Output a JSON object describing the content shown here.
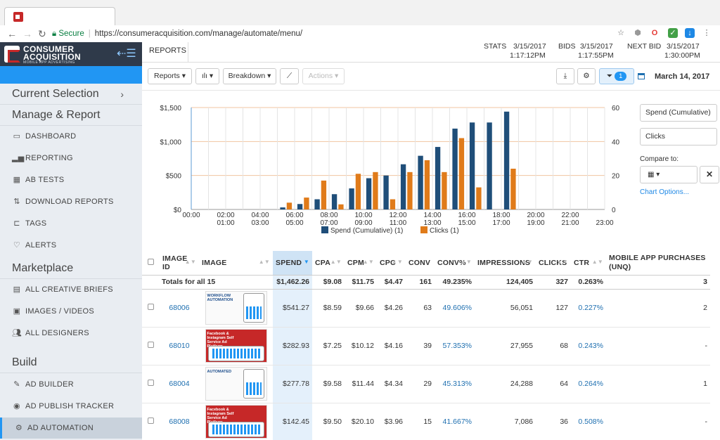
{
  "browser": {
    "secure_label": "Secure",
    "url": "https://consumeracquisition.com/manage/automate/menu/"
  },
  "brand": {
    "line1": "CONSUMER",
    "line2": "ACQUISITION",
    "tagline": "MOBILE APP ADVERTISING",
    "accent": "#2196f3"
  },
  "sidebar": {
    "current_selection": "Current Selection",
    "manage_report": "Manage & Report",
    "manage_items": [
      {
        "label": "DASHBOARD",
        "icon": "monitor-icon"
      },
      {
        "label": "REPORTING",
        "icon": "bar-chart-icon"
      },
      {
        "label": "AB TESTS",
        "icon": "grid-icon"
      },
      {
        "label": "DOWNLOAD REPORTS",
        "icon": "sort-icon"
      },
      {
        "label": "TAGS",
        "icon": "tag-icon"
      },
      {
        "label": "ALERTS",
        "icon": "bulb-icon"
      }
    ],
    "marketplace": "Marketplace",
    "marketplace_items": [
      {
        "label": "ALL CREATIVE BRIEFS",
        "icon": "document-icon"
      },
      {
        "label": "IMAGES / VIDEOS",
        "icon": "camera-icon"
      },
      {
        "label": "ALL DESIGNERS",
        "icon": "users-icon"
      }
    ],
    "build": "Build",
    "build_items": [
      {
        "label": "AD BUILDER",
        "icon": "tools-icon"
      },
      {
        "label": "AD PUBLISH TRACKER",
        "icon": "record-icon"
      },
      {
        "label": "AD AUTOMATION",
        "icon": "cogs-icon"
      }
    ]
  },
  "topbar": {
    "tab": "REPORTS",
    "stats_label": "STATS",
    "stats_date": "3/15/2017",
    "stats_time": "1:17:12PM",
    "bids_label": "BIDS",
    "bids_date": "3/15/2017",
    "bids_time": "1:17:55PM",
    "next_bid_label": "NEXT BID",
    "next_bid_date": "3/15/2017",
    "next_bid_time": "1:30:00PM"
  },
  "toolbar": {
    "reports": "Reports",
    "breakdown": "Breakdown",
    "actions": "Actions",
    "filter_count": "1",
    "date": "March 14, 2017"
  },
  "chart_controls": {
    "metric1": "Spend (Cumulative)",
    "metric2": "Clicks",
    "compare_label": "Compare to:",
    "chart_options": "Chart Options..."
  },
  "chart_data": {
    "type": "bar",
    "categories": [
      "00:00",
      "01:00",
      "02:00",
      "03:00",
      "04:00",
      "05:00",
      "06:00",
      "07:00",
      "08:00",
      "09:00",
      "10:00",
      "11:00",
      "12:00",
      "13:00",
      "14:00",
      "15:00",
      "16:00",
      "17:00",
      "18:00",
      "19:00",
      "20:00",
      "21:00",
      "22:00",
      "23:00"
    ],
    "series": [
      {
        "name": "Spend (Cumulative) (1)",
        "axis": "left",
        "color": "#1f4e79",
        "values": [
          0,
          0,
          0,
          0,
          0,
          30,
          80,
          150,
          225,
          310,
          460,
          500,
          665,
          790,
          920,
          1190,
          1280,
          1280,
          1440,
          null,
          null,
          null,
          null,
          null
        ]
      },
      {
        "name": "Clicks (1)",
        "axis": "right",
        "color": "#e07b1a",
        "values": [
          0,
          0,
          0,
          0,
          0,
          4,
          7,
          17,
          3,
          21,
          22,
          6,
          22,
          29,
          22,
          42,
          13,
          null,
          24,
          null,
          null,
          null,
          null,
          null
        ]
      }
    ],
    "y_left": {
      "ticks": [
        "$0",
        "$500",
        "$1,000",
        "$1,500"
      ],
      "range": [
        0,
        1500
      ]
    },
    "y_right": {
      "ticks": [
        "0",
        "20",
        "40",
        "60"
      ],
      "range": [
        0,
        60
      ]
    },
    "legend": [
      "Spend (Cumulative) (1)",
      "Clicks (1)"
    ],
    "legend_position": "bottom",
    "grid": true
  },
  "table": {
    "headers": [
      "IMAGE ID",
      "IMAGE",
      "SPEND",
      "CPA",
      "CPM",
      "CPC",
      "CONV",
      "CONV%",
      "IMPRESSIONS",
      "CLICKS",
      "CTR",
      "MOBILE APP PURCHASES (UNQ)"
    ],
    "totals": {
      "label": "Totals for all 15",
      "spend": "$1,462.26",
      "cpa": "$9.08",
      "cpm": "$11.75",
      "cpc": "$4.47",
      "conv": "161",
      "conv_pct": "49.235%",
      "impressions": "124,405",
      "clicks": "327",
      "ctr": "0.263%",
      "purchases": "3"
    },
    "rows": [
      {
        "id": "68006",
        "spend": "$541.27",
        "cpa": "$8.59",
        "cpm": "$9.66",
        "cpc": "$4.26",
        "conv": "63",
        "conv_pct": "49.606%",
        "impressions": "56,051",
        "clicks": "127",
        "ctr": "0.227%",
        "purchases": "2",
        "thumb_text": "WORKFLOW AUTOMATION"
      },
      {
        "id": "68010",
        "spend": "$282.93",
        "cpa": "$7.25",
        "cpm": "$10.12",
        "cpc": "$4.16",
        "conv": "39",
        "conv_pct": "57.353%",
        "impressions": "27,955",
        "clicks": "68",
        "ctr": "0.243%",
        "purchases": "-",
        "thumb_text": "Facebook & Instagram Self Service Ad Platform"
      },
      {
        "id": "68004",
        "spend": "$277.78",
        "cpa": "$9.58",
        "cpm": "$11.44",
        "cpc": "$4.34",
        "conv": "29",
        "conv_pct": "45.313%",
        "impressions": "24,288",
        "clicks": "64",
        "ctr": "0.264%",
        "purchases": "1",
        "thumb_text": "AUTOMATED"
      },
      {
        "id": "68008",
        "spend": "$142.45",
        "cpa": "$9.50",
        "cpm": "$20.10",
        "cpc": "$3.96",
        "conv": "15",
        "conv_pct": "41.667%",
        "impressions": "7,086",
        "clicks": "36",
        "ctr": "0.508%",
        "purchases": "-",
        "thumb_text": "Facebook & Instagram Self Service Ad Platform"
      }
    ]
  }
}
